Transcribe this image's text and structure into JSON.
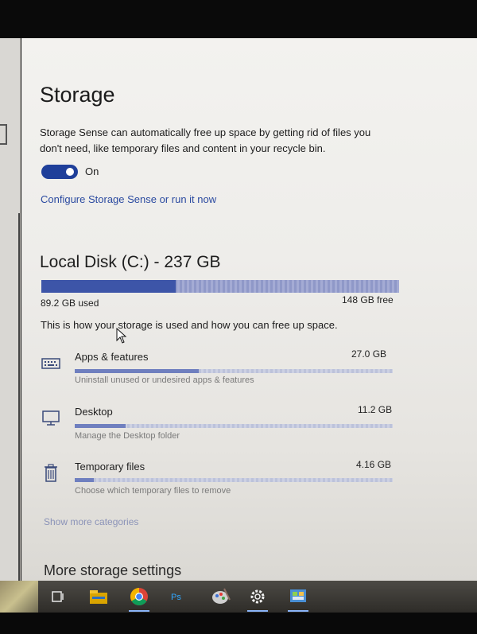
{
  "storage": {
    "title": "Storage",
    "sense_description": "Storage Sense can automatically free up space by getting rid of files you don't need, like temporary files and content in your recycle bin.",
    "toggle_state": "On",
    "configure_link": "Configure Storage Sense or run it now"
  },
  "disk": {
    "title": "Local Disk (C:) - 237 GB",
    "used_label": "89.2 GB used",
    "free_label": "148 GB free",
    "used_fraction": 0.376,
    "info_text": "This is how your storage is used and how you can free up space."
  },
  "categories": [
    {
      "name": "Apps & features",
      "size": "27.0 GB",
      "description": "Uninstall unused or undesired apps & features",
      "fill_fraction": 0.39,
      "icon": "keyboard-icon"
    },
    {
      "name": "Desktop",
      "size": "11.2 GB",
      "description": "Manage the Desktop folder",
      "fill_fraction": 0.16,
      "icon": "monitor-icon"
    },
    {
      "name": "Temporary files",
      "size": "4.16 GB",
      "description": "Choose which temporary files to remove",
      "fill_fraction": 0.06,
      "icon": "trash-icon"
    }
  ],
  "show_more": "Show more categories",
  "more_settings": "More storage settings",
  "taskbar": {
    "apps": [
      "task-view-icon",
      "file-explorer-icon",
      "chrome-icon",
      "photoshop-icon",
      "paint-icon",
      "settings-icon",
      "control-panel-icon"
    ],
    "photoshop_label": "Ps"
  },
  "colors": {
    "accent": "#1f3f9a",
    "link": "#2b4aa0",
    "used_bar": "#3d55a8",
    "free_bar": "#a4abd4"
  }
}
